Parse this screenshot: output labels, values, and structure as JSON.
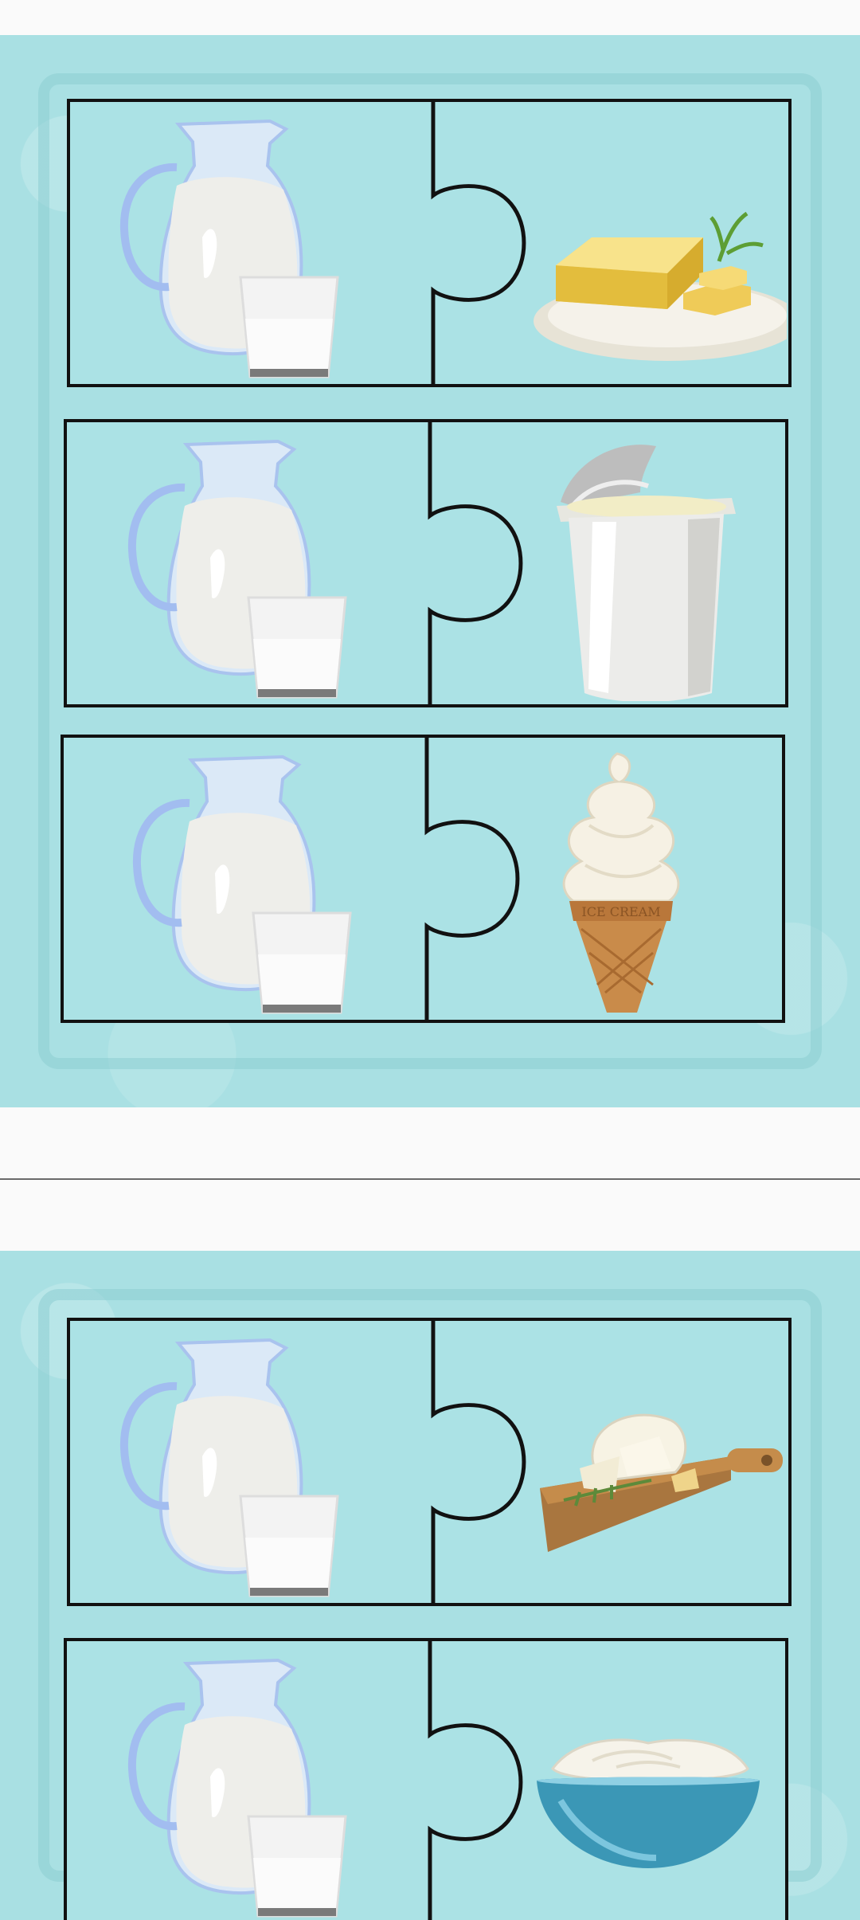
{
  "pages": [
    {
      "puzzles": [
        {
          "left_icon": "milk-jug-and-glass-icon",
          "right_icon": "butter-icon"
        },
        {
          "left_icon": "milk-jug-and-glass-icon",
          "right_icon": "yogurt-cup-icon"
        },
        {
          "left_icon": "milk-jug-and-glass-icon",
          "right_icon": "ice-cream-cone-icon",
          "cone_text": "ICE CREAM"
        }
      ]
    },
    {
      "puzzles": [
        {
          "left_icon": "milk-jug-and-glass-icon",
          "right_icon": "cheese-board-icon"
        },
        {
          "left_icon": "milk-jug-and-glass-icon",
          "right_icon": "sour-cream-bowl-icon"
        }
      ]
    }
  ],
  "colors": {
    "background": "#a9e0e3",
    "outline": "#111111",
    "divider": "#6a6a6a"
  }
}
